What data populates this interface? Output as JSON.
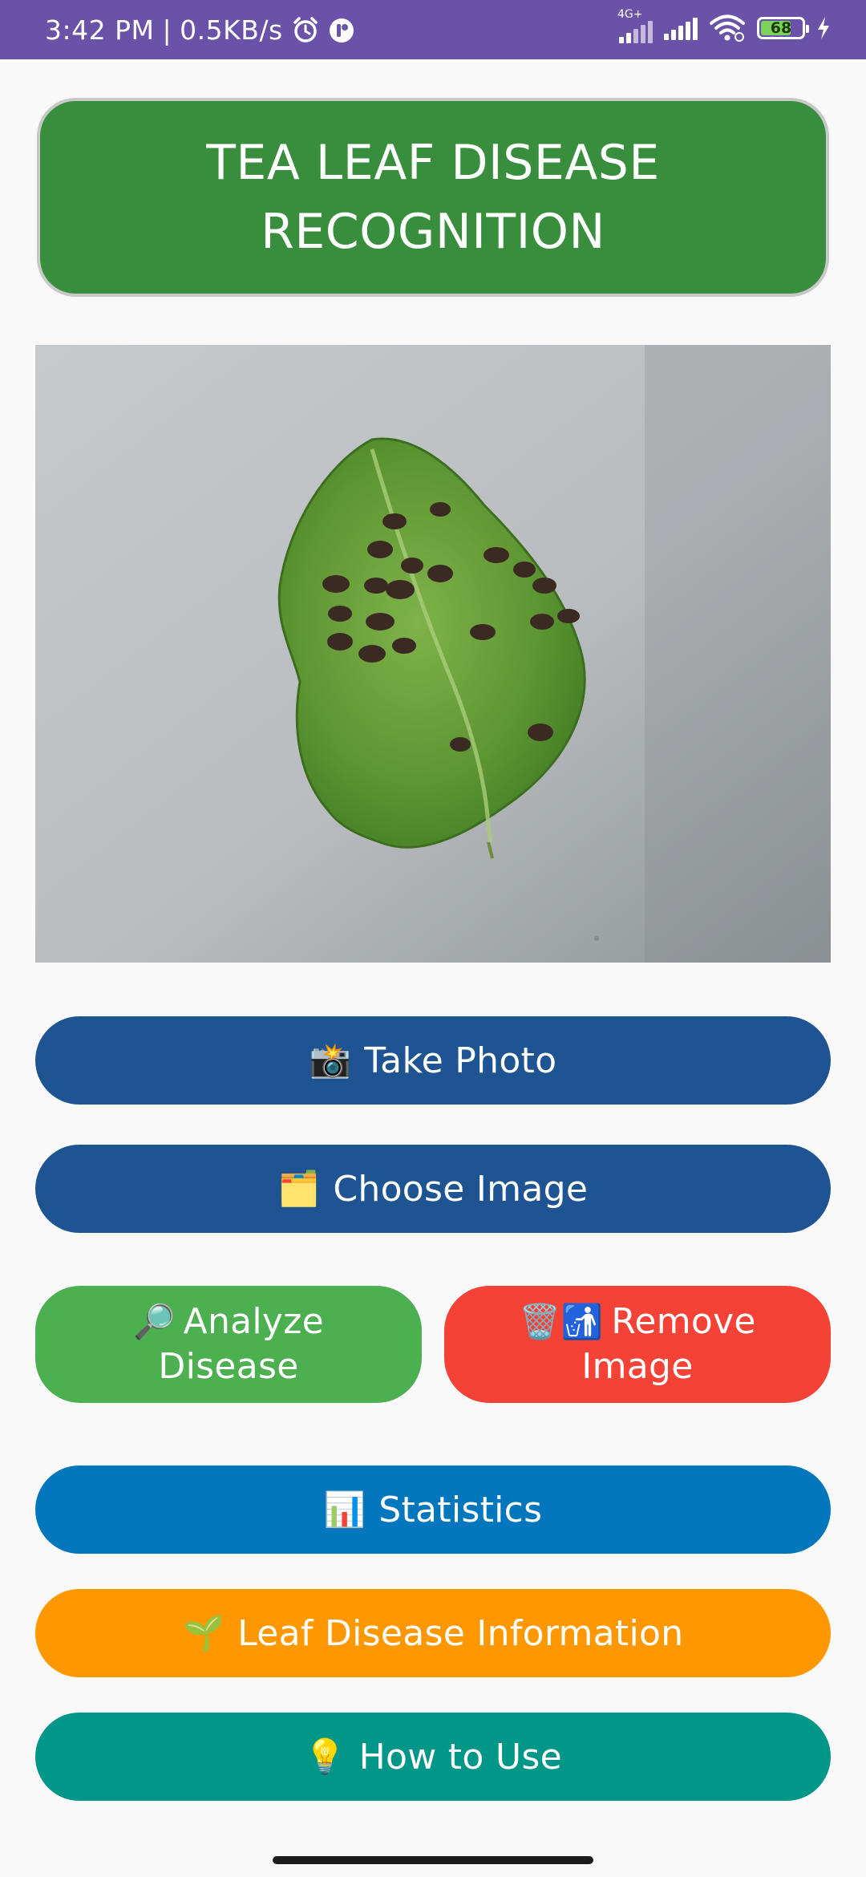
{
  "status_bar": {
    "time": "3:42 PM",
    "separator": "|",
    "speed": "0.5KB/s",
    "network_type": "4G+",
    "battery_level": "68",
    "battery_fraction": 0.68
  },
  "header": {
    "title": "TEA LEAF DISEASE RECOGNITION"
  },
  "buttons": {
    "take_photo": {
      "emoji": "📸",
      "label": "Take Photo"
    },
    "choose_image": {
      "emoji": "🗂️",
      "label": "Choose Image"
    },
    "analyze_disease": {
      "emoji": "🔎",
      "label": "Analyze Disease"
    },
    "remove_image": {
      "emoji": "🗑️🚮",
      "label": "Remove Image"
    },
    "statistics": {
      "emoji": "📊",
      "label": "Statistics"
    },
    "leaf_info": {
      "emoji": "🌱",
      "label": "Leaf Disease Information"
    },
    "how_to_use": {
      "emoji": "💡",
      "label": "How to Use"
    }
  },
  "colors": {
    "status_bar": "#6a52a8",
    "header": "#388e3c",
    "primary_blue": "#1d5491",
    "analyze_green": "#4caf50",
    "remove_red": "#f44336",
    "stats_blue": "#0277bd",
    "info_orange": "#ff9800",
    "howto_teal": "#009688"
  },
  "icons": {
    "alarm": "alarm-icon",
    "app_notification": "notification-icon",
    "signal": "signal-icon",
    "wifi": "wifi-icon",
    "battery": "battery-icon",
    "charging": "charging-icon"
  }
}
